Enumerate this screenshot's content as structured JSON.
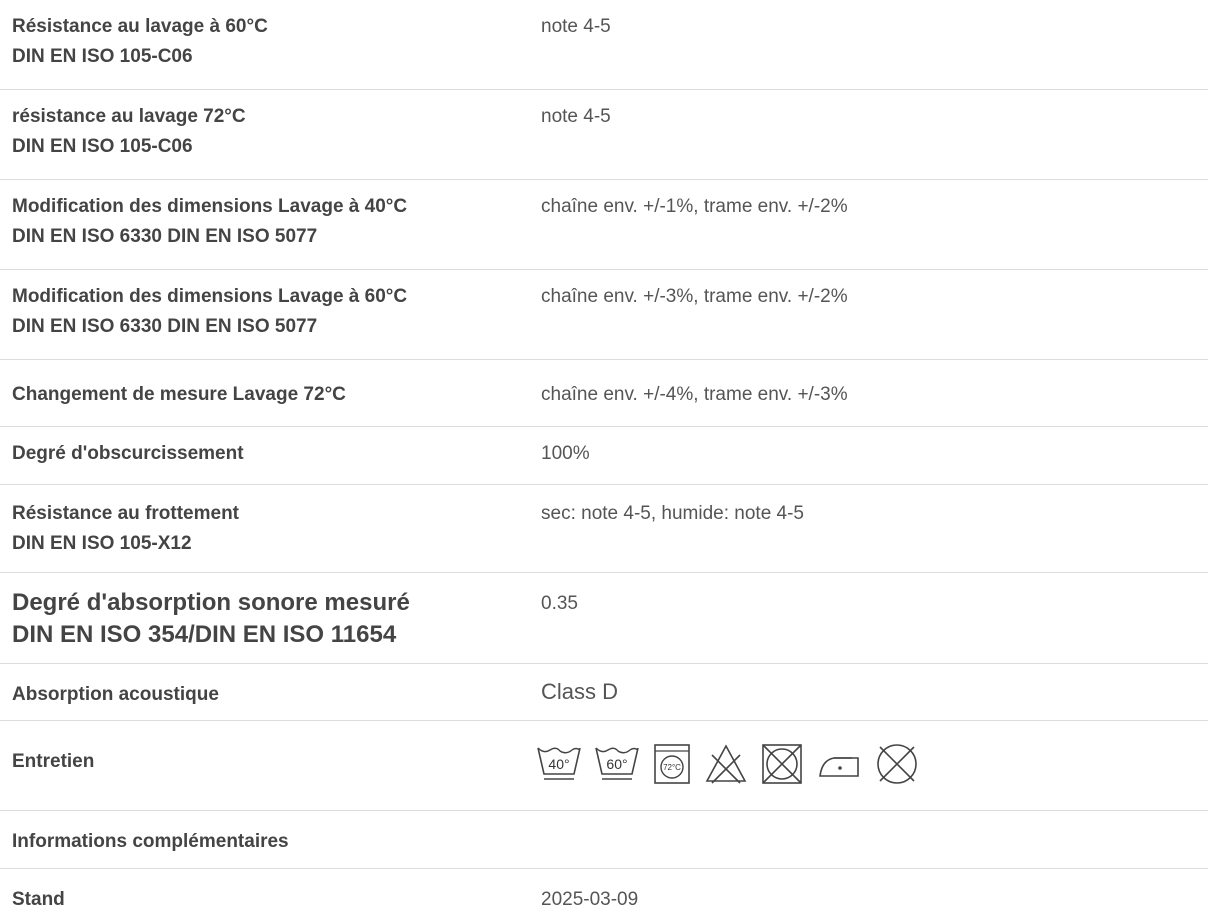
{
  "rows": [
    {
      "label_1": "Résistance au lavage à 60°C",
      "label_2": "DIN EN ISO 105-C06",
      "value": "note 4-5"
    },
    {
      "label_1": "résistance au lavage 72°C",
      "label_2": "DIN EN ISO 105-C06",
      "value": "note 4-5"
    },
    {
      "label_1": "Modification des dimensions Lavage à 40°C",
      "label_2": "DIN EN ISO 6330 DIN EN ISO 5077",
      "value": "chaîne env. +/-1%, trame env. +/-2%"
    },
    {
      "label_1": "Modification des dimensions Lavage à 60°C",
      "label_2": "DIN EN ISO 6330 DIN EN ISO 5077",
      "value": "chaîne env. +/-3%, trame env. +/-2%"
    },
    {
      "label_1": "Changement de mesure Lavage 72°C",
      "value": "chaîne env. +/-4%, trame env. +/-3%"
    },
    {
      "label_1": "Degré d'obscurcissement",
      "value": "100%"
    },
    {
      "label_1": "Résistance au frottement",
      "label_2": "DIN EN ISO 105-X12",
      "value": "sec: note 4-5, humide: note 4-5"
    },
    {
      "label_1": "Degré d'absorption sonore mesuré",
      "label_2": "DIN EN ISO 354/DIN EN ISO 11654",
      "value": "0.35"
    },
    {
      "label_1": "Absorption acoustique",
      "value": "Class D"
    },
    {
      "label_1": "Entretien"
    },
    {
      "label_1": "Informations complémentaires"
    },
    {
      "label_1": "Stand",
      "value": "2025-03-09"
    }
  ],
  "care_icons": [
    {
      "name": "wash-40-icon",
      "text": "40°"
    },
    {
      "name": "wash-60-icon",
      "text": "60°"
    },
    {
      "name": "tumble-dry-72-icon",
      "text": "72°C"
    },
    {
      "name": "do-not-bleach-icon"
    },
    {
      "name": "do-not-tumble-dry-icon"
    },
    {
      "name": "iron-low-icon"
    },
    {
      "name": "do-not-dry-clean-icon"
    }
  ]
}
